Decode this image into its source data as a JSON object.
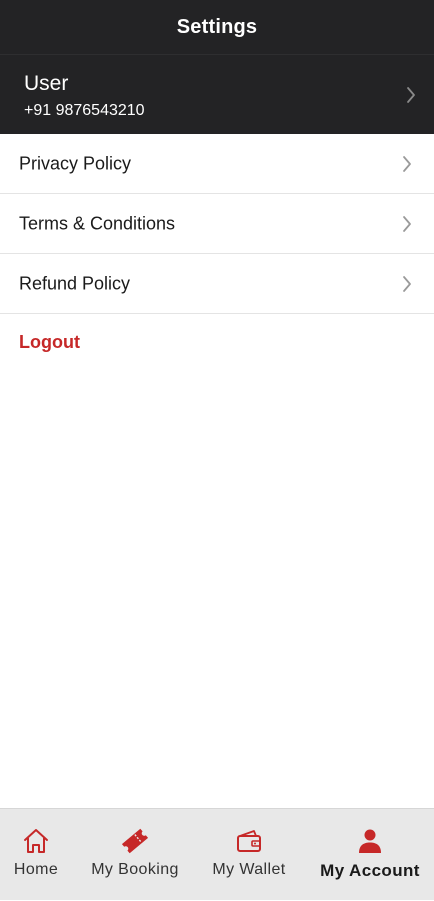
{
  "header": {
    "title": "Settings"
  },
  "profile": {
    "name": "User",
    "phone": "+91 9876543210"
  },
  "menu": {
    "items": [
      {
        "label": "Privacy Policy"
      },
      {
        "label": "Terms & Conditions"
      },
      {
        "label": "Refund Policy"
      }
    ],
    "logout_label": "Logout"
  },
  "tabbar": {
    "tabs": [
      {
        "label": "Home",
        "icon": "home-icon",
        "active": false
      },
      {
        "label": "My Booking",
        "icon": "ticket-icon",
        "active": false
      },
      {
        "label": "My Wallet",
        "icon": "wallet-icon",
        "active": false
      },
      {
        "label": "My Account",
        "icon": "person-icon",
        "active": true
      }
    ]
  },
  "colors": {
    "header_bg": "#232325",
    "accent": "#c62828",
    "tabbar_bg": "#e8e8e8"
  }
}
